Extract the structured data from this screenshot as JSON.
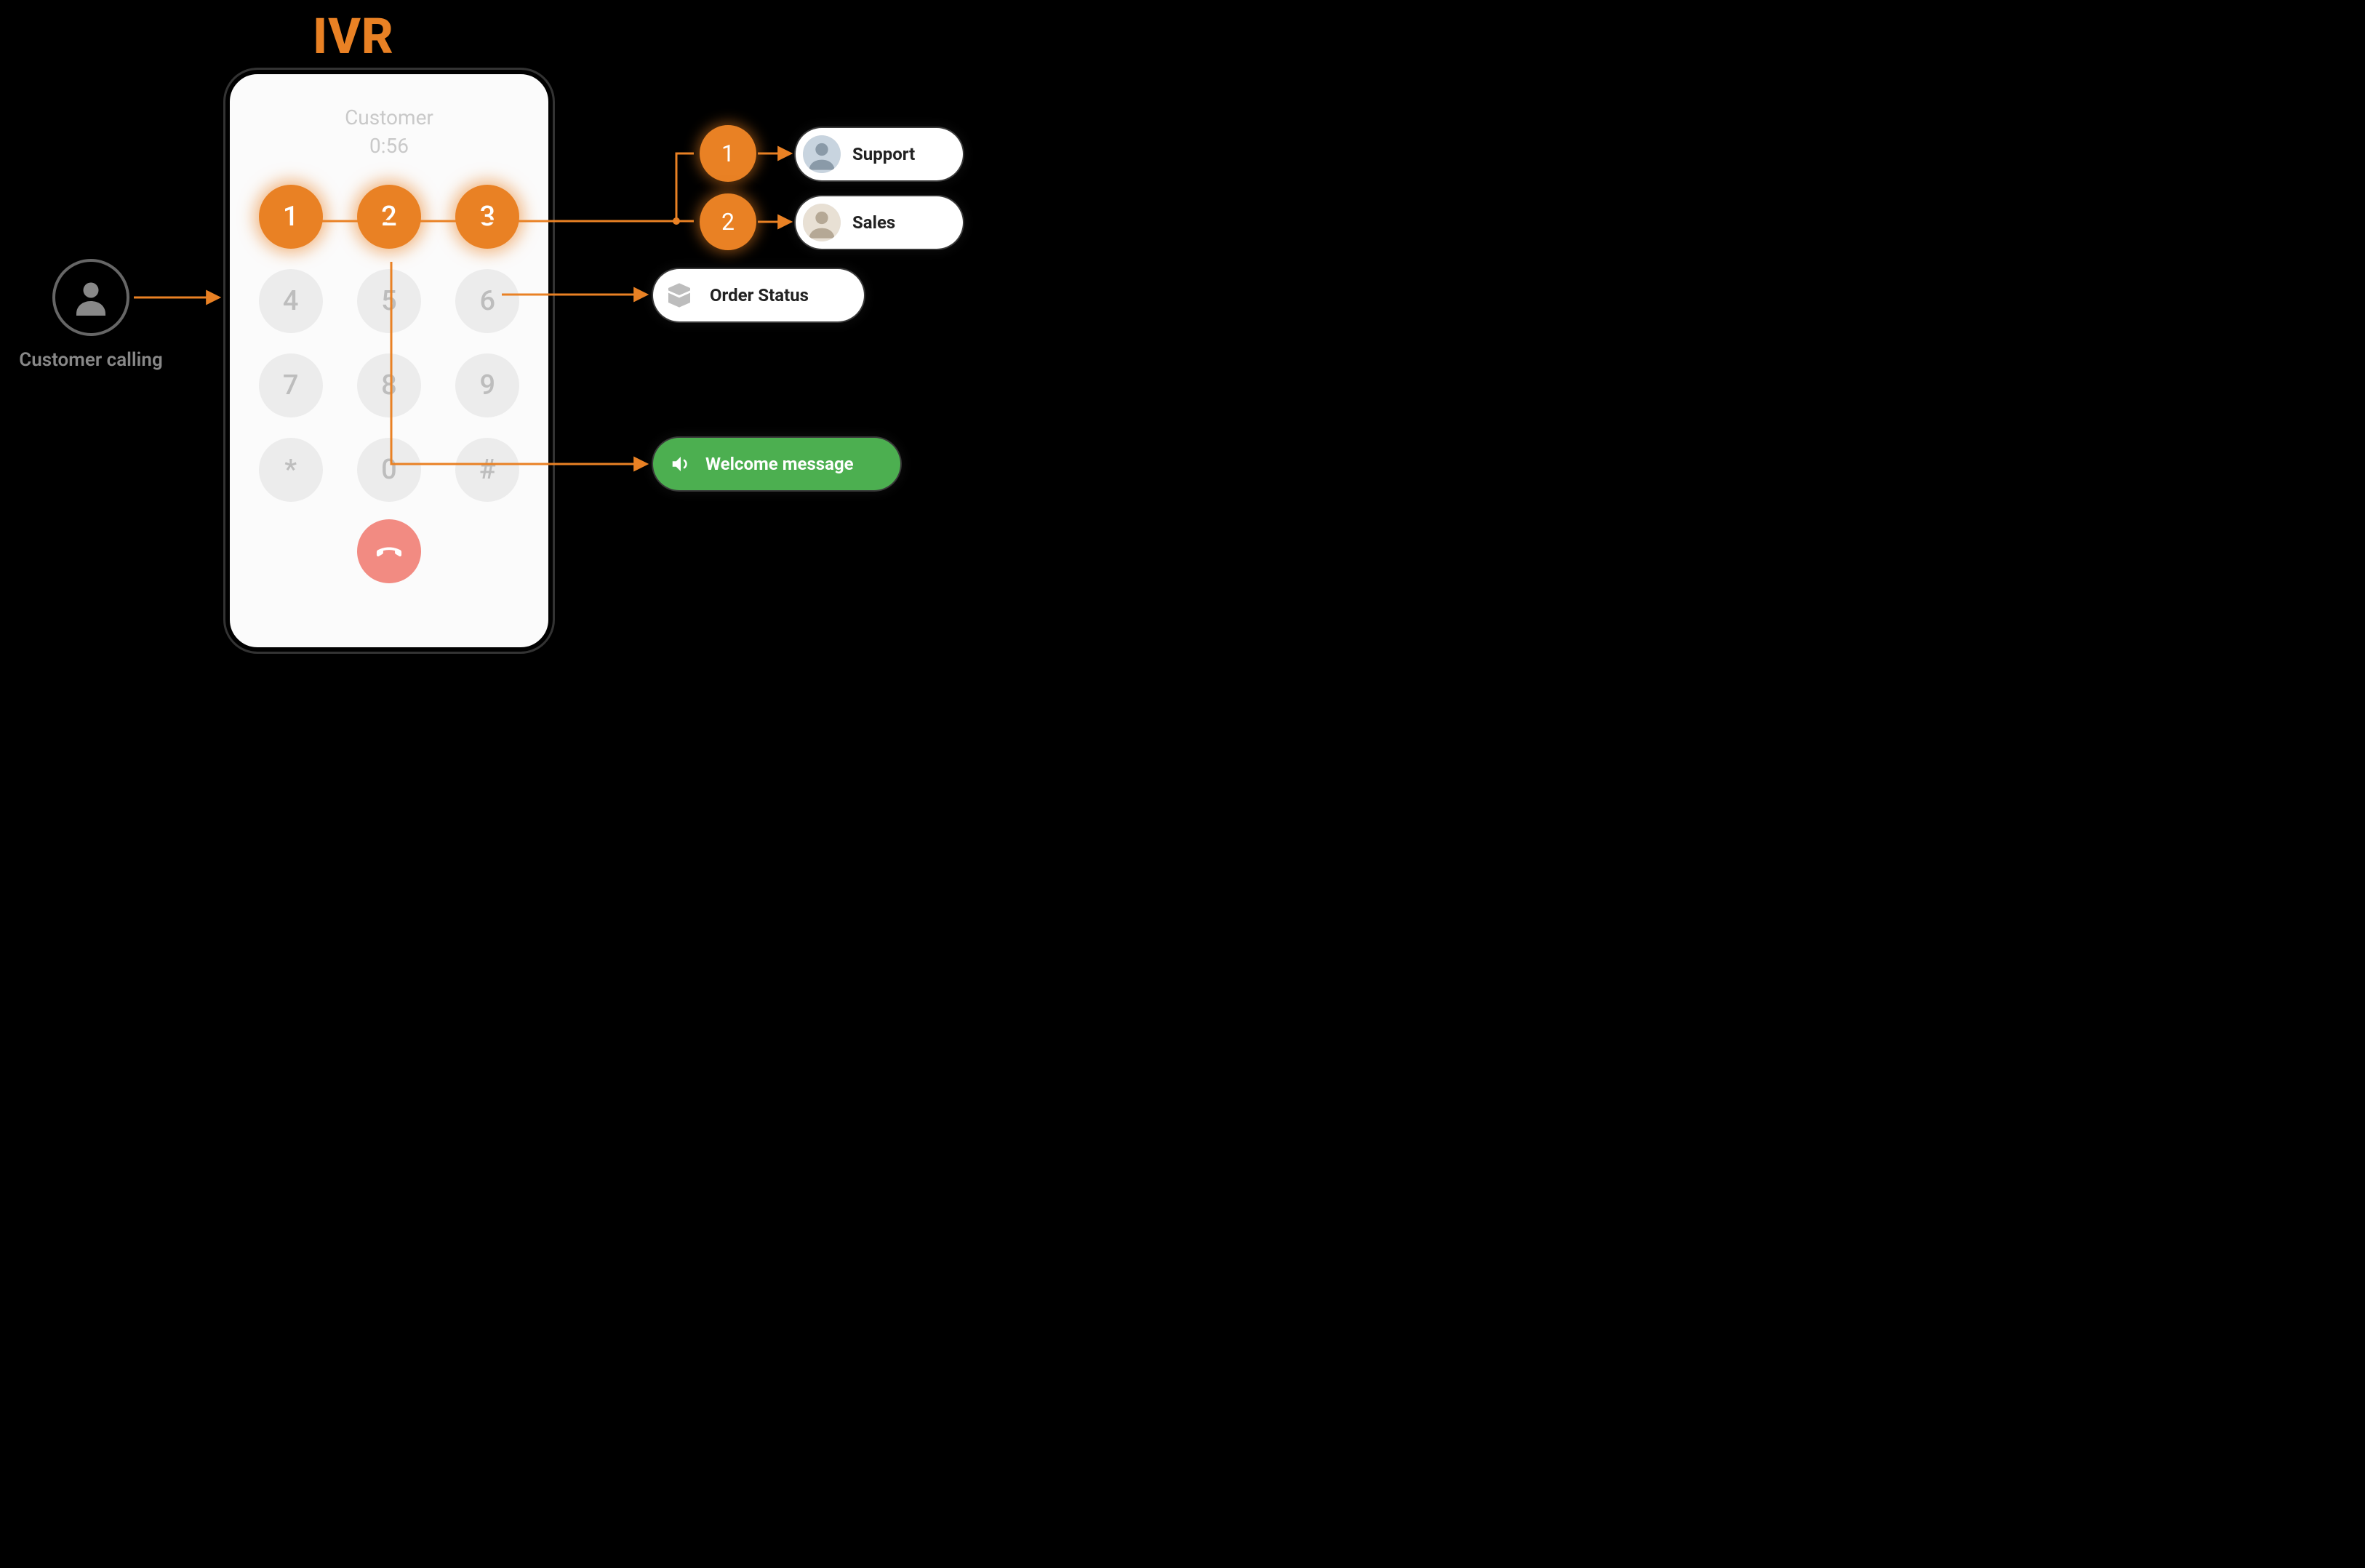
{
  "title": "IVR",
  "caller": {
    "label": "Customer calling"
  },
  "phone": {
    "header_name": "Customer",
    "header_time": "0:56",
    "keys": [
      "1",
      "2",
      "3",
      "4",
      "5",
      "6",
      "7",
      "8",
      "9",
      "*",
      "0",
      "#"
    ]
  },
  "options": {
    "sub1": "1",
    "sub2": "2"
  },
  "targets": {
    "support": "Support",
    "sales": "Sales",
    "order_status": "Order Status",
    "welcome": "Welcome message"
  },
  "colors": {
    "orange": "#E98124",
    "green": "#4CAF50"
  }
}
